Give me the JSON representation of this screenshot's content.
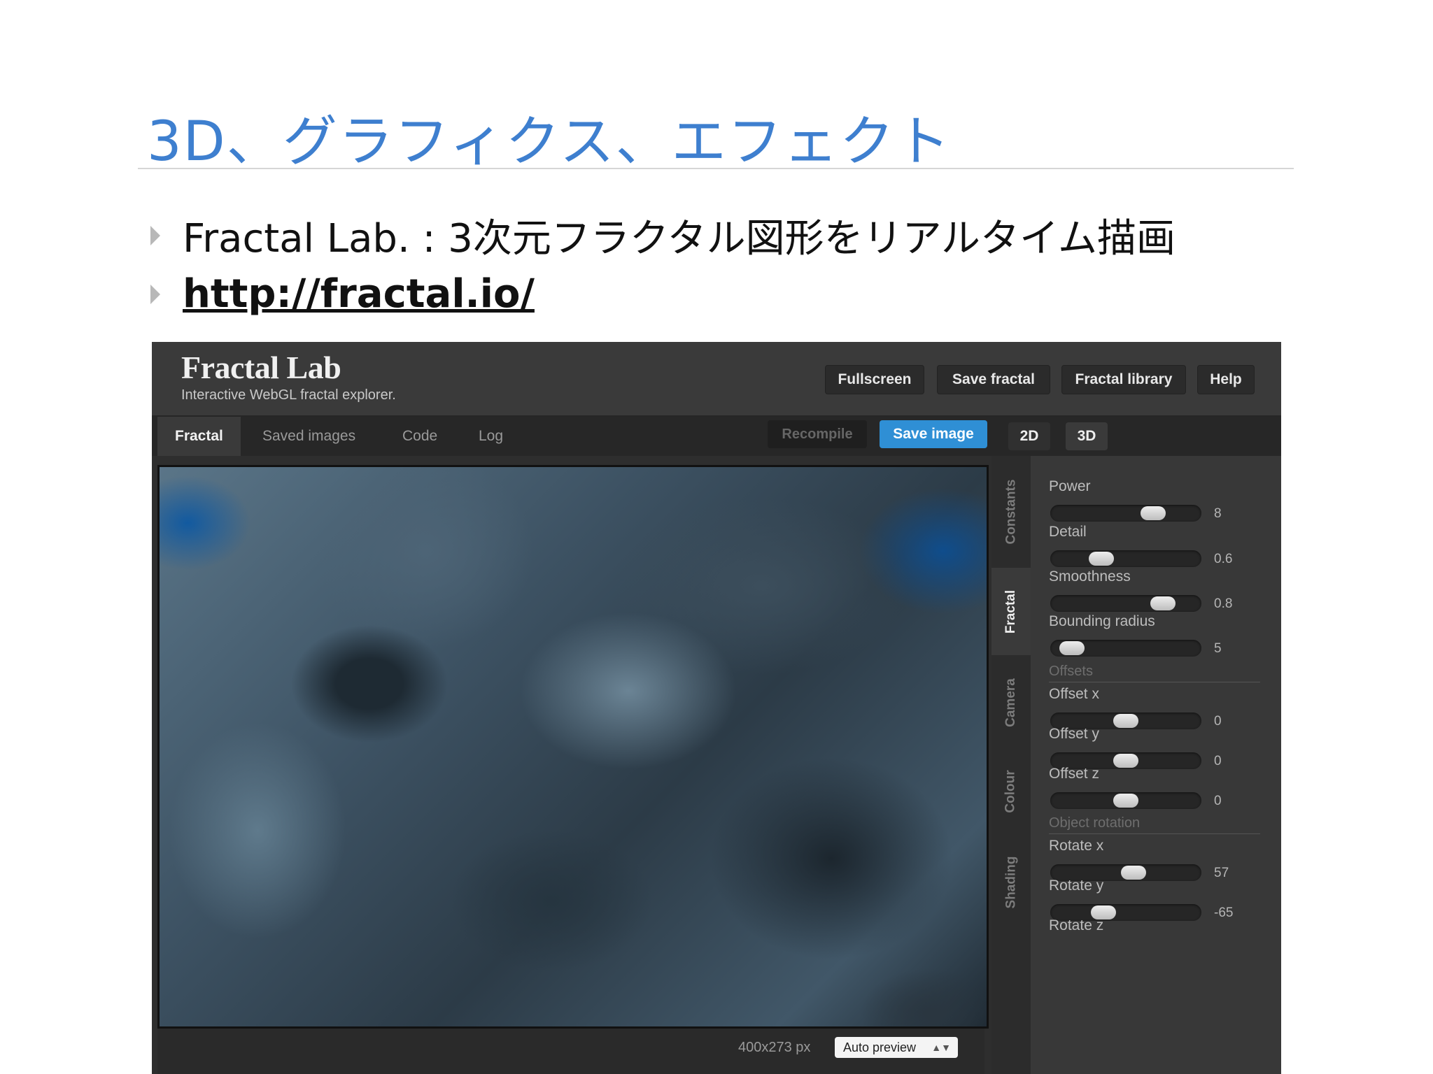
{
  "slide": {
    "title": "3D、グラフィクス、エフェクト",
    "bullets": [
      {
        "text": "Fractal Lab. : 3次元フラクタル図形をリアルタイム描画"
      },
      {
        "text": "http://fractal.io/"
      }
    ]
  },
  "app": {
    "logo": "Fractal Lab",
    "tagline": "Interactive WebGL fractal explorer.",
    "header_buttons": {
      "fullscreen": "Fullscreen",
      "save_fractal": "Save fractal",
      "fractal_library": "Fractal library",
      "help": "Help"
    },
    "tabs": {
      "fractal": "Fractal",
      "saved_images": "Saved images",
      "code": "Code",
      "log": "Log"
    },
    "actions": {
      "recompile": "Recompile",
      "save_image": "Save image"
    },
    "modes": {
      "d2": "2D",
      "d3": "3D"
    },
    "side_tabs": {
      "constants": "Constants",
      "fractal": "Fractal",
      "camera": "Camera",
      "colour": "Colour",
      "shading": "Shading"
    },
    "params": {
      "power": {
        "label": "Power",
        "value": "8",
        "level": 0.72
      },
      "detail": {
        "label": "Detail",
        "value": "0.6",
        "level": 0.3
      },
      "smoothness": {
        "label": "Smoothness",
        "value": "0.8",
        "level": 0.8
      },
      "bounding_radius": {
        "label": "Bounding radius",
        "value": "5",
        "level": 0.06
      },
      "offsets_section": "Offsets",
      "offset_x": {
        "label": "Offset x",
        "value": "0",
        "level": 0.5
      },
      "offset_y": {
        "label": "Offset y",
        "value": "0",
        "level": 0.5
      },
      "offset_z": {
        "label": "Offset z",
        "value": "0",
        "level": 0.5
      },
      "rotation_section": "Object rotation",
      "rotate_x": {
        "label": "Rotate x",
        "value": "57",
        "level": 0.56
      },
      "rotate_y": {
        "label": "Rotate y",
        "value": "-65",
        "level": 0.32
      },
      "rotate_z": {
        "label": "Rotate z"
      }
    },
    "viewport": {
      "resolution": "400x273 px",
      "preview_select": "Auto preview"
    }
  }
}
